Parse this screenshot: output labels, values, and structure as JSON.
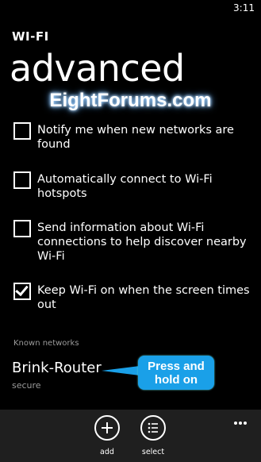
{
  "status_bar": {
    "time": "3:11"
  },
  "header": {
    "app_title": "WI-FI",
    "page_title": "advanced"
  },
  "watermark": "EightForums.com",
  "options": [
    {
      "label": "Notify me when new networks are found",
      "checked": false
    },
    {
      "label": "Automatically connect to Wi-Fi hotspots",
      "checked": false
    },
    {
      "label": "Send information about Wi-Fi connections to help discover nearby Wi-Fi",
      "checked": false
    },
    {
      "label": "Keep Wi-Fi on when the screen times out",
      "checked": true
    }
  ],
  "known_networks": {
    "header": "Known networks",
    "items": [
      {
        "name": "Brink-Router",
        "status": "secure"
      }
    ]
  },
  "callout": {
    "line1": "Press and",
    "line2": "hold on"
  },
  "app_bar": {
    "buttons": [
      {
        "label": "add",
        "icon": "plus-icon"
      },
      {
        "label": "select",
        "icon": "select-list-icon"
      }
    ],
    "more_icon": "ellipsis-icon"
  },
  "colors": {
    "background": "#000000",
    "app_bar": "#1f1f1f",
    "callout": "#1aa0e8",
    "secondary_text": "#9a9a9a"
  }
}
